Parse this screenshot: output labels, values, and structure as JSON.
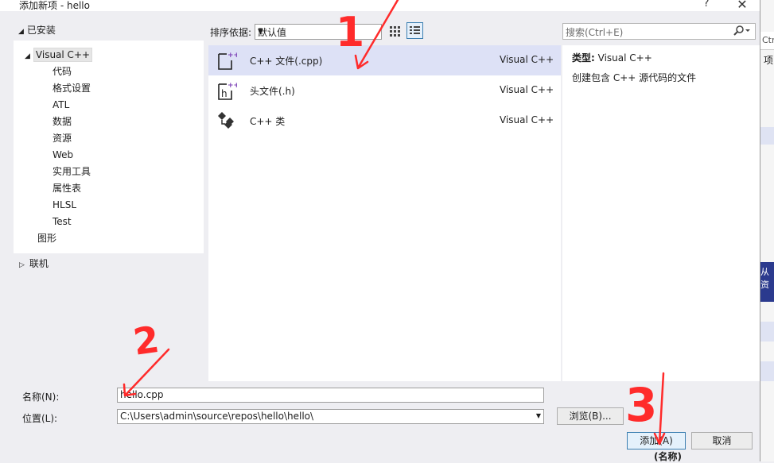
{
  "dialog": {
    "title": "添加新项 - hello",
    "help_label": "?",
    "close_label": "✕"
  },
  "tree": {
    "installed_label": "已安装",
    "items": [
      {
        "label": "Visual C++"
      },
      {
        "label": "代码"
      },
      {
        "label": "格式设置"
      },
      {
        "label": "ATL"
      },
      {
        "label": "数据"
      },
      {
        "label": "资源"
      },
      {
        "label": "Web"
      },
      {
        "label": "实用工具"
      },
      {
        "label": "属性表"
      },
      {
        "label": "HLSL"
      },
      {
        "label": "Test"
      },
      {
        "label": "图形"
      }
    ],
    "online_label": "联机"
  },
  "toolbar": {
    "sort_label": "排序依据:",
    "sort_value": "默认值",
    "search_placeholder": "搜索(Ctrl+E)"
  },
  "templates": [
    {
      "name": "C++ 文件(.cpp)",
      "lang": "Visual C++",
      "icon": "cpp-file-icon",
      "selected": true
    },
    {
      "name": "头文件(.h)",
      "lang": "Visual C++",
      "icon": "header-file-icon",
      "selected": false
    },
    {
      "name": "C++ 类",
      "lang": "Visual C++",
      "icon": "cpp-class-icon",
      "selected": false
    }
  ],
  "details": {
    "type_label": "类型:",
    "type_value": "Visual C++",
    "description": "创建包含 C++ 源代码的文件"
  },
  "form": {
    "name_label": "名称(N):",
    "name_value": "hello.cpp",
    "location_label": "位置(L):",
    "location_value": "C:\\Users\\admin\\source\\repos\\hello\\hello\\",
    "browse_label": "浏览(B)...",
    "add_label": "添加(A)",
    "cancel_label": "取消"
  },
  "background": {
    "ctrl_fragment": "Ctr",
    "item_fragment": "项",
    "res_fragment": "从资",
    "name_fragment": "(名称)"
  },
  "annotations": {
    "step1": "1",
    "step2": "2",
    "step3": "3",
    "color": "#ff2b2b"
  },
  "colors": {
    "selection": "#dde1f6",
    "accent": "#3c7fb1",
    "ide_blue": "#2b3a8e"
  }
}
